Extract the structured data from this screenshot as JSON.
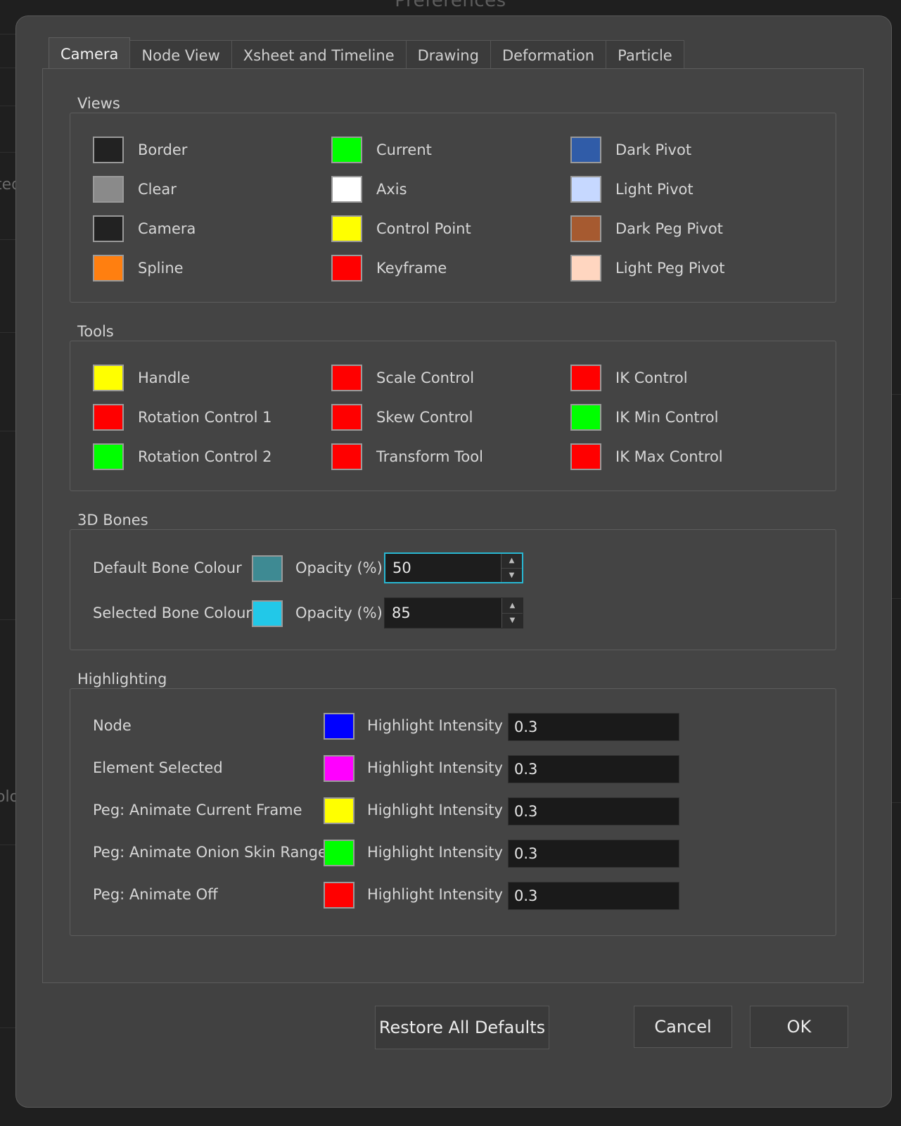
{
  "window": {
    "title": "Preferences"
  },
  "background": {
    "fragment_1": "ted",
    "fragment_2": "olo"
  },
  "tabs": [
    "Camera",
    "Node View",
    "Xsheet and Timeline",
    "Drawing",
    "Deformation",
    "Particle"
  ],
  "active_tab": "Camera",
  "views": {
    "title": "Views",
    "items": [
      {
        "label": "Border",
        "color": "#222222"
      },
      {
        "label": "Clear",
        "color": "#8a8a8a"
      },
      {
        "label": "Camera",
        "color": "#222222"
      },
      {
        "label": "Spline",
        "color": "#ff7f10"
      },
      {
        "label": "Current",
        "color": "#00ff00"
      },
      {
        "label": "Axis",
        "color": "#ffffff"
      },
      {
        "label": "Control Point",
        "color": "#ffff00"
      },
      {
        "label": "Keyframe",
        "color": "#ff0000"
      },
      {
        "label": "Dark Pivot",
        "color": "#305ca8"
      },
      {
        "label": "Light Pivot",
        "color": "#c6d8ff"
      },
      {
        "label": "Dark Peg Pivot",
        "color": "#a65a30"
      },
      {
        "label": "Light Peg Pivot",
        "color": "#ffd6c0"
      }
    ]
  },
  "tools": {
    "title": "Tools",
    "items": [
      {
        "label": "Handle",
        "color": "#ffff00"
      },
      {
        "label": "Rotation Control 1",
        "color": "#ff0000"
      },
      {
        "label": "Rotation Control 2",
        "color": "#00ff00"
      },
      {
        "label": "Scale Control",
        "color": "#ff0000"
      },
      {
        "label": "Skew Control",
        "color": "#ff0000"
      },
      {
        "label": "Transform Tool",
        "color": "#ff0000"
      },
      {
        "label": "IK Control",
        "color": "#ff0000"
      },
      {
        "label": "IK Min Control",
        "color": "#00ff00"
      },
      {
        "label": "IK Max Control",
        "color": "#ff0000"
      }
    ]
  },
  "bones": {
    "title": "3D Bones",
    "rows": [
      {
        "label": "Default Bone Colour",
        "color": "#3e8a93",
        "opacity_label": "Opacity (%)",
        "opacity": "50"
      },
      {
        "label": "Selected Bone Colour",
        "color": "#22c8e8",
        "opacity_label": "Opacity (%)",
        "opacity": "85"
      }
    ]
  },
  "highlighting": {
    "title": "Highlighting",
    "rows": [
      {
        "label": "Node",
        "color": "#0000ff",
        "intensity_label": "Highlight Intensity",
        "intensity": "0.3"
      },
      {
        "label": "Element Selected",
        "color": "#ff00ff",
        "intensity_label": "Highlight Intensity",
        "intensity": "0.3"
      },
      {
        "label": "Peg: Animate Current Frame",
        "color": "#ffff00",
        "intensity_label": "Highlight Intensity",
        "intensity": "0.3"
      },
      {
        "label": "Peg: Animate Onion Skin Range",
        "color": "#00ff00",
        "intensity_label": "Highlight Intensity",
        "intensity": "0.3"
      },
      {
        "label": "Peg: Animate Off",
        "color": "#ff0000",
        "intensity_label": "Highlight Intensity",
        "intensity": "0.3"
      }
    ]
  },
  "buttons": {
    "restore": "Restore All Defaults",
    "cancel": "Cancel",
    "ok": "OK"
  }
}
